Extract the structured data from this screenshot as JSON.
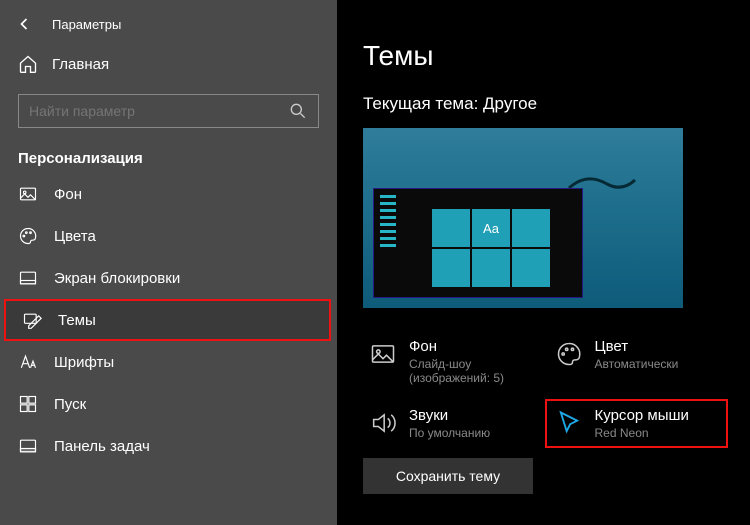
{
  "header": {
    "app_title": "Параметры"
  },
  "sidebar": {
    "home": "Главная",
    "search_placeholder": "Найти параметр",
    "section": "Персонализация",
    "items": [
      {
        "label": "Фон"
      },
      {
        "label": "Цвета"
      },
      {
        "label": "Экран блокировки"
      },
      {
        "label": "Темы"
      },
      {
        "label": "Шрифты"
      },
      {
        "label": "Пуск"
      },
      {
        "label": "Панель задач"
      }
    ]
  },
  "main": {
    "heading": "Темы",
    "current_theme_label": "Текущая тема:",
    "current_theme_value": "Другое",
    "preview_sample": "Aa",
    "settings": {
      "background": {
        "title": "Фон",
        "sub": "Слайд-шоу (изображений: 5)"
      },
      "color": {
        "title": "Цвет",
        "sub": "Автоматически"
      },
      "sounds": {
        "title": "Звуки",
        "sub": "По умолчанию"
      },
      "cursor": {
        "title": "Курсор мыши",
        "sub": "Red Neon"
      }
    },
    "save_button": "Сохранить тему"
  }
}
